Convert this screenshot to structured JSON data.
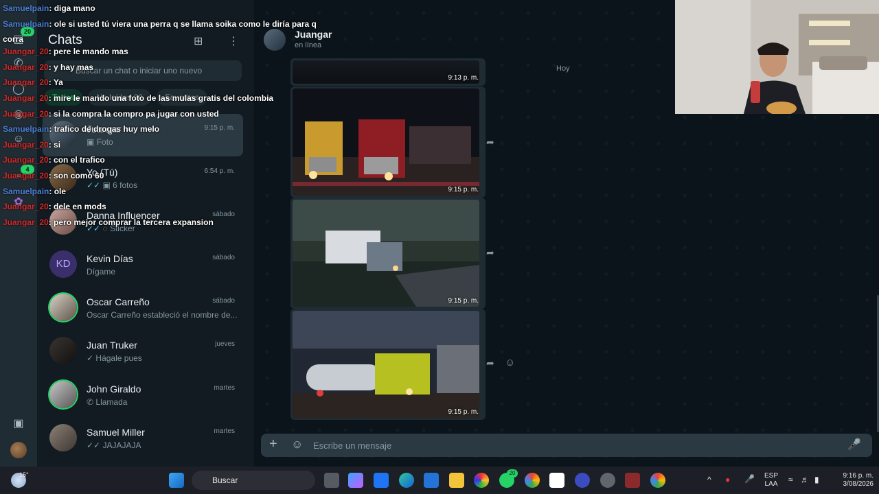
{
  "rail": {
    "badge_chats": "20",
    "badge_status": "4"
  },
  "list": {
    "title": "Chats",
    "search_placeholder": "Buscar un chat o iniciar uno nuevo",
    "filters": [
      "Todos",
      "No leídos 20",
      "Favoritos"
    ],
    "chats": [
      {
        "name": "Juangar",
        "time": "9:15 p. m.",
        "preview": "Foto",
        "icon": "photo-icon",
        "active": true
      },
      {
        "name": "Yo (Tú)",
        "time": "6:54 p. m.",
        "preview": "6 fotos",
        "icon": "photo-icon"
      },
      {
        "name": "Danna Influencer",
        "time": "sábado",
        "preview": "Sticker",
        "icon": "sticker-icon"
      },
      {
        "name": "Kevin Días",
        "time": "sábado",
        "preview": "Dígame",
        "initials": "KD"
      },
      {
        "name": "Oscar Carreño",
        "time": "sábado",
        "preview": "Oscar Carreño estableció el nombre de..."
      },
      {
        "name": "Juan Truker",
        "time": "jueves",
        "preview": "Hágale pues"
      },
      {
        "name": "John Giraldo",
        "time": "martes",
        "preview": "Llamada",
        "icon": "call-icon"
      },
      {
        "name": "Samuel Miller",
        "time": "martes",
        "preview": "JAJAJAJA"
      }
    ]
  },
  "conversation": {
    "name": "Juangar",
    "status": "en línea",
    "day_label": "Hoy",
    "messages": [
      {
        "time": "9:13 p. m."
      },
      {
        "time": "9:15 p. m."
      },
      {
        "time": "9:15 p. m."
      },
      {
        "time": "9:15 p. m."
      }
    ],
    "composer_placeholder": "Escribe un mensaje"
  },
  "stream_chat": [
    {
      "user": "Samuelpain",
      "text": ": diga mano"
    },
    {
      "user": "Samuelpain",
      "text": ": ole si usted tú viera una perra q se llama soika como le diría para q"
    },
    {
      "user": "",
      "text": "corra"
    },
    {
      "user": "Juangar_20",
      "text": ": pere le mando mas"
    },
    {
      "user": "Juangar_20",
      "text": ": y hay mas"
    },
    {
      "user": "Juangar_20",
      "text": ": Ya"
    },
    {
      "user": "Juangar_20",
      "text": ": mire le mando una foto de las mulas gratis del colombia"
    },
    {
      "user": "Juangar_20",
      "text": ": si la compra la compro pa jugar con usted"
    },
    {
      "user": "Samuelpain",
      "text": ": trafico de drogas huy melo"
    },
    {
      "user": "Juangar_20",
      "text": ": si"
    },
    {
      "user": "Juangar_20",
      "text": ": con el trafico"
    },
    {
      "user": "Juangar_20",
      "text": ": son como 60"
    },
    {
      "user": "Samuelpain",
      "text": ": ole"
    },
    {
      "user": "Juangar_20",
      "text": ": dele en mods"
    },
    {
      "user": "Juangar_20",
      "text": ": pero mejor comprar la tercera expansion"
    }
  ],
  "taskbar": {
    "weather": "15°",
    "search": "Buscar",
    "whatsapp_badge": "20",
    "lang_top": "ESP",
    "lang_bottom": "LAA",
    "time": "9:16 p. m.",
    "date": "3/08/2026"
  }
}
